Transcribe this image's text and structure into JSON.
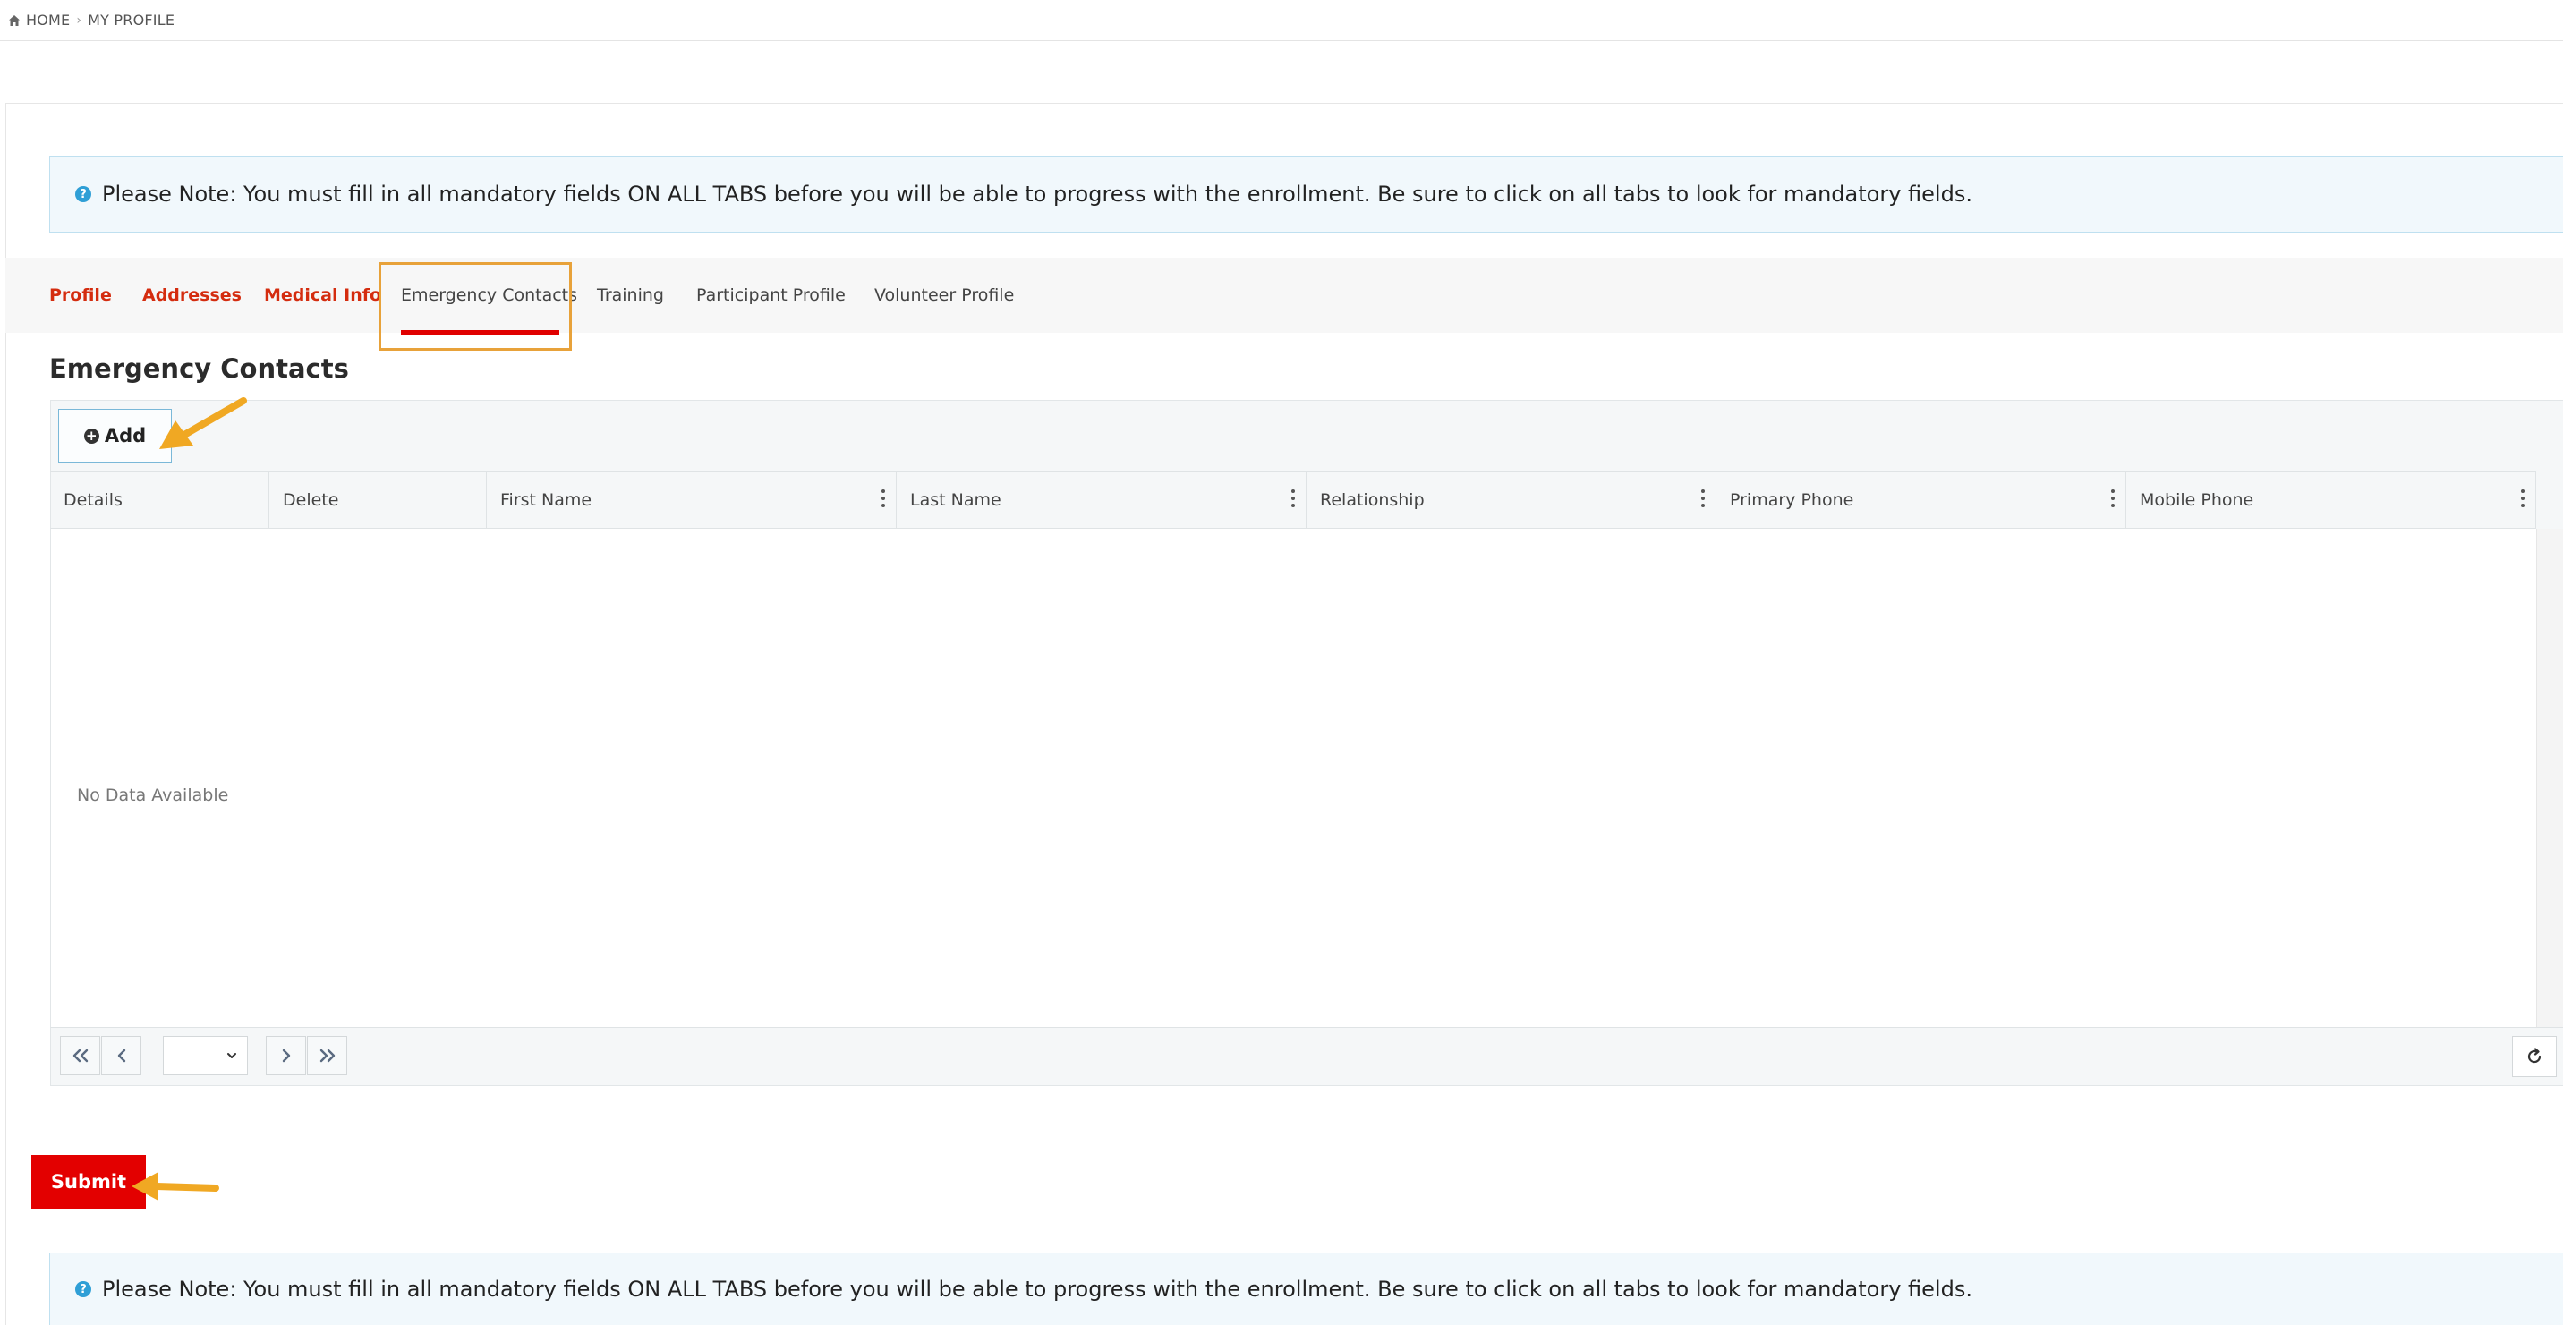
{
  "breadcrumb": {
    "home": "HOME",
    "current": "MY PROFILE"
  },
  "notice": {
    "text": "Please Note: You must fill in all mandatory fields ON ALL TABS before you will be able to progress with the enrollment. Be sure to click on all tabs to look for mandatory fields."
  },
  "tabs": [
    {
      "label": "Profile",
      "state": "completed"
    },
    {
      "label": "Addresses",
      "state": "completed"
    },
    {
      "label": "Medical Info",
      "state": "completed"
    },
    {
      "label": "Emergency Contacts",
      "state": "active"
    },
    {
      "label": "Training",
      "state": "default"
    },
    {
      "label": "Participant Profile",
      "state": "default"
    },
    {
      "label": "Volunteer Profile",
      "state": "default"
    }
  ],
  "section": {
    "title": "Emergency Contacts"
  },
  "grid": {
    "add_label": "Add",
    "columns": [
      {
        "label": "Details",
        "menu": false
      },
      {
        "label": "Delete",
        "menu": false
      },
      {
        "label": "First Name",
        "menu": true
      },
      {
        "label": "Last Name",
        "menu": true
      },
      {
        "label": "Relationship",
        "menu": true
      },
      {
        "label": "Primary Phone",
        "menu": true
      },
      {
        "label": "Mobile Phone",
        "menu": true
      }
    ],
    "empty_text": "No Data Available",
    "page_select_value": ""
  },
  "submit_label": "Submit",
  "colors": {
    "accent_red": "#e30000",
    "completed_tab": "#d42c0f",
    "highlight": "#e8a23a",
    "info_blue": "#2f9fd6"
  },
  "icons": [
    "home-icon",
    "info-icon",
    "plus-circle-icon",
    "column-menu-icon",
    "first-page-icon",
    "previous-page-icon",
    "chevron-down-icon",
    "next-page-icon",
    "last-page-icon",
    "refresh-icon",
    "annotation-arrow"
  ]
}
